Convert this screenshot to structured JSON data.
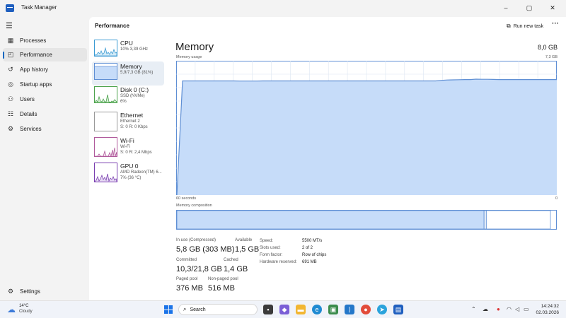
{
  "window": {
    "title": "Task Manager",
    "controls": {
      "minimize": "–",
      "maximize": "▢",
      "close": "✕"
    }
  },
  "nav": {
    "menu_icon": "hamburger-icon",
    "items": [
      {
        "label": "Processes",
        "icon": "processes-icon",
        "active": false
      },
      {
        "label": "Performance",
        "icon": "performance-icon",
        "active": true
      },
      {
        "label": "App history",
        "icon": "history-icon",
        "active": false
      },
      {
        "label": "Startup apps",
        "icon": "startup-icon",
        "active": false
      },
      {
        "label": "Users",
        "icon": "users-icon",
        "active": false
      },
      {
        "label": "Details",
        "icon": "details-icon",
        "active": false
      },
      {
        "label": "Services",
        "icon": "services-icon",
        "active": false
      }
    ],
    "settings": {
      "label": "Settings",
      "icon": "gear-icon"
    }
  },
  "header": {
    "title": "Performance",
    "run_new_task": "Run new task",
    "more": "···"
  },
  "resources": [
    {
      "name": "CPU",
      "sub1": "10%  3,39 GHz",
      "sub2": "",
      "sub3": "",
      "color": "#3c9bd3",
      "active": false
    },
    {
      "name": "Memory",
      "sub1": "5,9/7,3 GB (81%)",
      "sub2": "",
      "sub3": "",
      "color": "#5f8fd4",
      "active": true
    },
    {
      "name": "Disk 0 (C:)",
      "sub1": "SSD (NVMe)",
      "sub2": "6%",
      "sub3": "",
      "color": "#4da34d",
      "active": false
    },
    {
      "name": "Ethernet",
      "sub1": "Ethernet 2",
      "sub2": "S: 0  R: 0 Kbps",
      "sub3": "",
      "color": "#b05a9c",
      "active": false
    },
    {
      "name": "Wi-Fi",
      "sub1": "Wi-Fi",
      "sub2": "S: 0  R: 2,4 Mbps",
      "sub3": "",
      "color": "#b05a9c",
      "active": false
    },
    {
      "name": "GPU 0",
      "sub1": "AMD Radeon(TM) 6...",
      "sub2": "7% (36 °C)",
      "sub3": "",
      "color": "#7a3fb0",
      "active": false
    }
  ],
  "detail": {
    "title": "Memory",
    "total": "8,0 GB",
    "usage_label": "Memory usage",
    "usage_max": "7,3 GB",
    "time_span": "60 seconds",
    "time_zero": "0",
    "composition_label": "Memory composition",
    "usage_percent_history": [
      0,
      85,
      85,
      85,
      85,
      85,
      85,
      85,
      85,
      85,
      85,
      84.9,
      84.9,
      84.9,
      84.9,
      85,
      85,
      85,
      85,
      85,
      85,
      85,
      85,
      85,
      85,
      85,
      85,
      85,
      85,
      85,
      85,
      85,
      85,
      85,
      85,
      85,
      85,
      85,
      85,
      85,
      85,
      85,
      85,
      85,
      85,
      85,
      85.4,
      85.7,
      85.8,
      85.9,
      86,
      86,
      86.3,
      86.2,
      86.2,
      86.1,
      86,
      86,
      86,
      86,
      86,
      86,
      86,
      86,
      86,
      86,
      86
    ]
  },
  "composition": {
    "in_use_fraction": 0.81,
    "modified_fraction": 0.006,
    "standby_fraction": 0.18
  },
  "stats": [
    {
      "label": "In use (Compressed)",
      "value": "5,8 GB (303 MB)"
    },
    {
      "label": "Available",
      "value": "1,5 GB"
    },
    {
      "label": "Committed",
      "value": "10,3/21,8 GB"
    },
    {
      "label": "Cached",
      "value": "1,4 GB"
    },
    {
      "label": "Paged pool",
      "value": "376 MB"
    },
    {
      "label": "Non-paged pool",
      "value": "516 MB"
    }
  ],
  "specs": [
    {
      "label": "Speed:",
      "value": "5500 MT/s"
    },
    {
      "label": "Slots used:",
      "value": "2 of 2"
    },
    {
      "label": "Form factor:",
      "value": "Row of chips"
    },
    {
      "label": "Hardware reserved:",
      "value": "691 MB"
    }
  ],
  "colors": {
    "memory_line": "#5f8fd4",
    "memory_fill": "#c6dcf9",
    "grid": "#dde6f2",
    "accent": "#0067c0"
  },
  "taskbar": {
    "weather_temp": "14°C",
    "weather_desc": "Cloudy",
    "search_placeholder": "Search",
    "time": "14:24:32",
    "date": "02.03.2026"
  }
}
